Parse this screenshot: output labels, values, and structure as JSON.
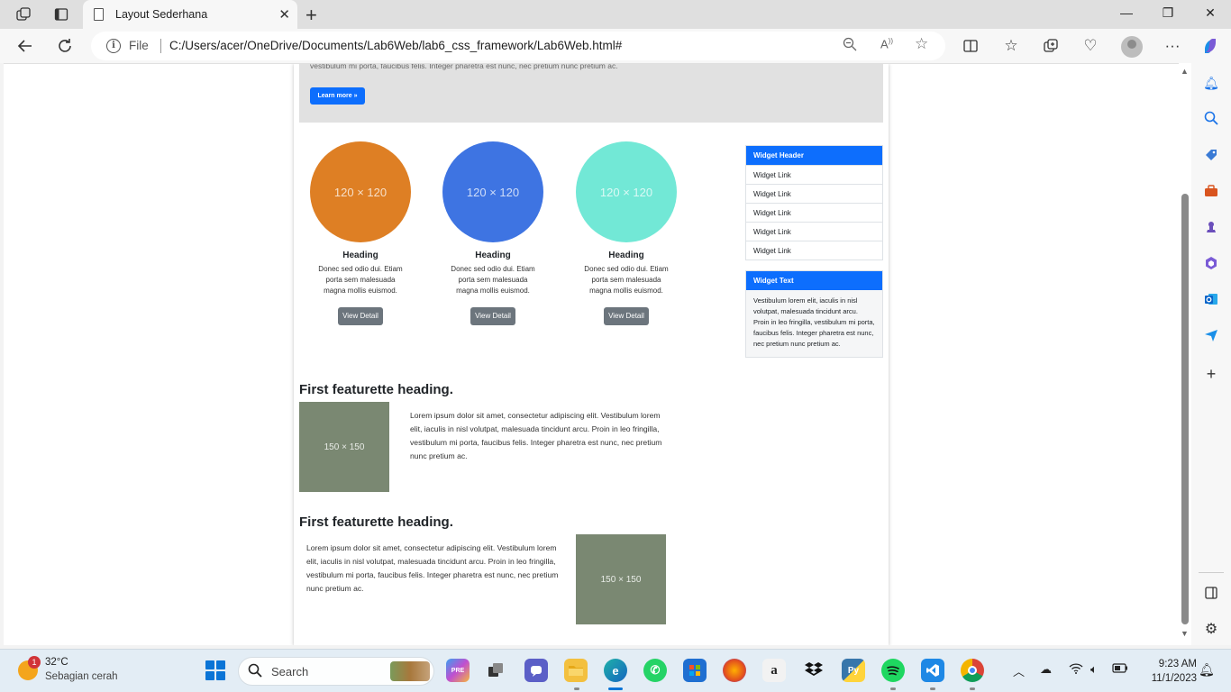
{
  "browser": {
    "tab_title": "Layout Sederhana",
    "address_scheme_label": "File",
    "url": "C:/Users/acer/OneDrive/Documents/Lab6Web/lab6_css_framework/Lab6Web.html#"
  },
  "page": {
    "jumbotron": {
      "text": "vestibulum mi porta, faucibus felis. Integer pharetra est nunc, nec pretium nunc pretium ac.",
      "button": "Learn more »"
    },
    "features": [
      {
        "image_label": "120 × 120",
        "heading": "Heading",
        "text": "Donec sed odio dui. Etiam porta sem malesuada magna mollis euismod.",
        "button": "View Detail",
        "color": "#de7f24"
      },
      {
        "image_label": "120 × 120",
        "heading": "Heading",
        "text": "Donec sed odio dui. Etiam porta sem malesuada magna mollis euismod.",
        "button": "View Detail",
        "color": "#3e74e2"
      },
      {
        "image_label": "120 × 120",
        "heading": "Heading",
        "text": "Donec sed odio dui. Etiam porta sem malesuada magna mollis euismod.",
        "button": "View Detail",
        "color": "#72e8d6"
      }
    ],
    "widget_links": {
      "header": "Widget Header",
      "links": [
        "Widget Link",
        "Widget Link",
        "Widget Link",
        "Widget Link",
        "Widget Link"
      ]
    },
    "widget_text": {
      "header": "Widget Text",
      "body": "Vestibulum lorem elit, iaculis in nisl volutpat, malesuada tincidunt arcu. Proin in leo fringilla, vestibulum mi porta, faucibus felis. Integer pharetra est nunc, nec pretium nunc pretium ac."
    },
    "featurettes": [
      {
        "heading": "First featurette heading.",
        "image_label": "150 × 150",
        "text": "Lorem ipsum dolor sit amet, consectetur adipiscing elit. Vestibulum lorem elit, iaculis in nisl volutpat, malesuada tincidunt arcu. Proin in leo fringilla, vestibulum mi porta, faucibus felis. Integer pharetra est nunc, nec pretium nunc pretium ac."
      },
      {
        "heading": "First featurette heading.",
        "image_label": "150 × 150",
        "text": "Lorem ipsum dolor sit amet, consectetur adipiscing elit. Vestibulum lorem elit, iaculis in nisl volutpat, malesuada tincidunt arcu. Proin in leo fringilla, vestibulum mi porta, faucibus felis. Integer pharetra est nunc, nec pretium nunc pretium ac."
      }
    ]
  },
  "taskbar": {
    "weather_badge": "1",
    "temperature": "32°C",
    "weather": "Sebagian cerah",
    "search_placeholder": "Search",
    "time": "9:23 AM",
    "date": "11/1/2023",
    "apps": [
      "copilot-pre",
      "task-view",
      "teams-chat",
      "file-explorer",
      "edge",
      "whatsapp",
      "microsoft-store",
      "firefox",
      "amazon",
      "dropbox",
      "python",
      "spotify",
      "vscode",
      "chrome"
    ]
  },
  "colors": {
    "primary": "#0d6efd",
    "secondary": "#6c757d",
    "placeholder": "#7a8872"
  }
}
